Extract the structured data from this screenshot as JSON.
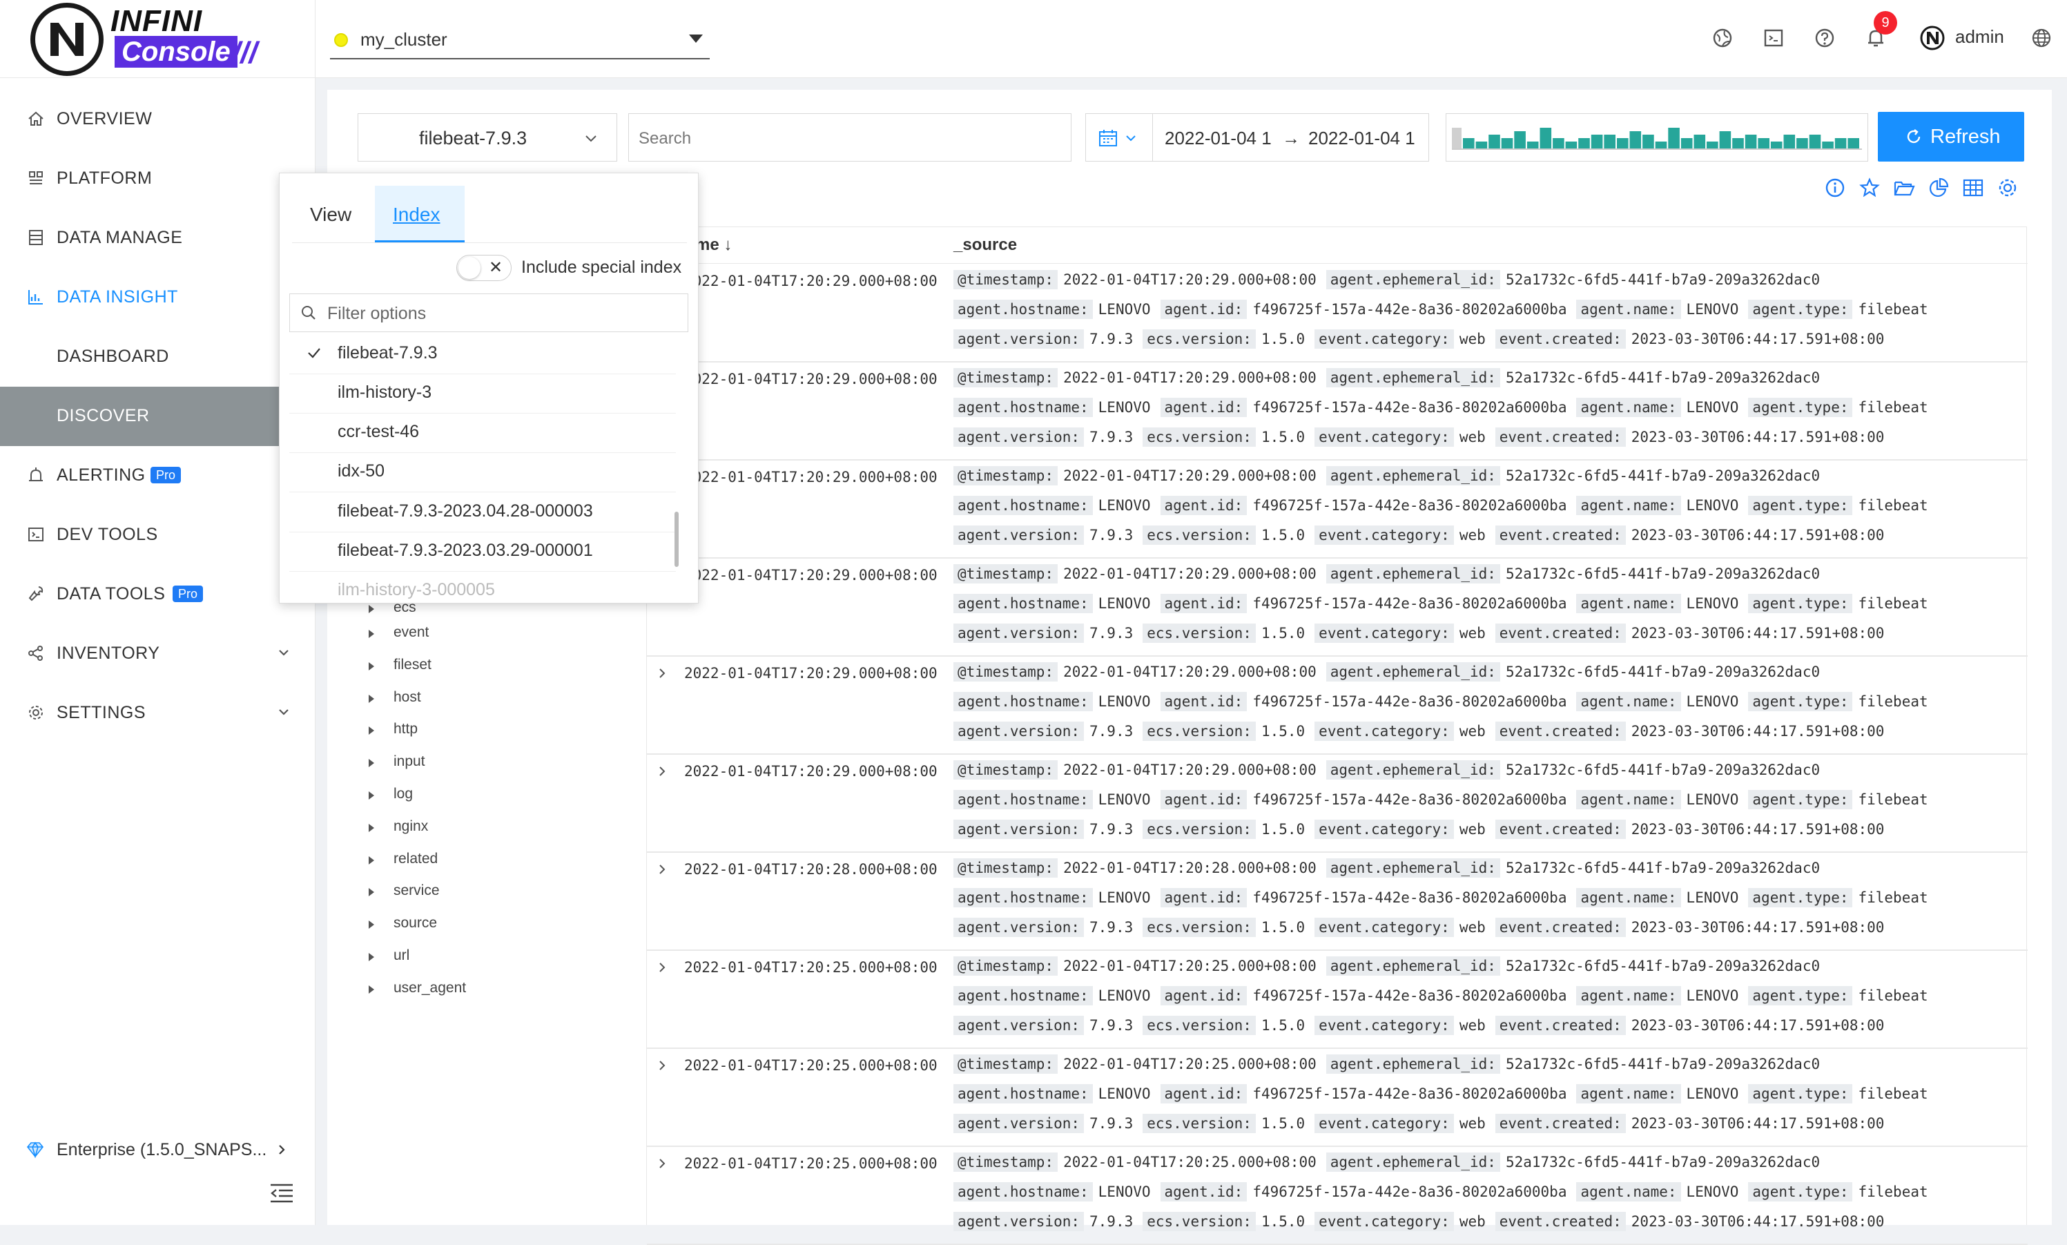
{
  "header": {
    "logo_top": "INFINI",
    "logo_bottom": "Console",
    "logo_slashes": "///",
    "cluster_name": "my_cluster",
    "notification_count": "9",
    "user_name": "admin",
    "icons": [
      "status-globe-icon",
      "terminal-icon",
      "help-icon",
      "bell-icon",
      "user-avatar-icon",
      "language-icon"
    ]
  },
  "sidebar": {
    "items": [
      {
        "label": "OVERVIEW",
        "icon": "home-icon"
      },
      {
        "label": "PLATFORM",
        "icon": "platform-icon"
      },
      {
        "label": "DATA MANAGE",
        "icon": "database-icon"
      },
      {
        "label": "DATA INSIGHT",
        "icon": "chart-icon"
      },
      {
        "label": "DASHBOARD"
      },
      {
        "label": "DISCOVER"
      },
      {
        "label": "ALERTING",
        "icon": "alarm-icon",
        "badge": "Pro"
      },
      {
        "label": "DEV TOOLS",
        "icon": "console-icon"
      },
      {
        "label": "DATA TOOLS",
        "icon": "wrench-icon",
        "badge": "Pro"
      },
      {
        "label": "INVENTORY",
        "icon": "share-icon"
      },
      {
        "label": "SETTINGS",
        "icon": "gear-icon"
      }
    ],
    "enterprise": "Enterprise (1.5.0_SNAPS...",
    "accent_color": "#1890ff",
    "selected_bg": "#8c9396"
  },
  "toolbar": {
    "index_value": "filebeat-7.9.3",
    "search_placeholder": "Search",
    "date_from": "2022-01-04 1",
    "date_arrow": "→",
    "date_to": "2022-01-04 1",
    "refresh_label": "Refresh",
    "histogram_values": [
      3,
      2,
      4,
      3,
      5,
      2,
      6,
      3,
      2,
      3,
      4,
      4,
      3,
      5,
      4,
      2,
      6,
      3,
      4,
      2,
      5,
      3,
      4,
      3,
      2,
      4,
      3,
      4,
      2,
      3,
      3
    ]
  },
  "dropdown": {
    "tab_view": "View",
    "tab_index": "Index",
    "include_special": "Include special index",
    "toggle_x": "✕",
    "filter_placeholder": "Filter options",
    "options": [
      "filebeat-7.9.3",
      "ilm-history-3",
      "ccr-test-46",
      "idx-50",
      "filebeat-7.9.3-2023.04.28-000003",
      "filebeat-7.9.3-2023.03.29-000001",
      "ilm-history-3-000005"
    ],
    "selected_index": 0
  },
  "fields": [
    "ecs",
    "event",
    "fileset",
    "host",
    "http",
    "input",
    "log",
    "nginx",
    "related",
    "service",
    "source",
    "url",
    "user_agent"
  ],
  "table": {
    "col_time": "me ↓",
    "col_source": "_source",
    "rows": [
      {
        "time": "2022-01-04T17:20:29.000+08:00",
        "ts": "2022-01-04T17:20:29.000+08:00"
      },
      {
        "time": "2022-01-04T17:20:29.000+08:00",
        "ts": "2022-01-04T17:20:29.000+08:00"
      },
      {
        "time": "2022-01-04T17:20:29.000+08:00",
        "ts": "2022-01-04T17:20:29.000+08:00"
      },
      {
        "time": "2022-01-04T17:20:29.000+08:00",
        "ts": "2022-01-04T17:20:29.000+08:00"
      },
      {
        "time": "2022-01-04T17:20:29.000+08:00",
        "ts": "2022-01-04T17:20:29.000+08:00"
      },
      {
        "time": "2022-01-04T17:20:29.000+08:00",
        "ts": "2022-01-04T17:20:29.000+08:00"
      },
      {
        "time": "2022-01-04T17:20:28.000+08:00",
        "ts": "2022-01-04T17:20:28.000+08:00"
      },
      {
        "time": "2022-01-04T17:20:25.000+08:00",
        "ts": "2022-01-04T17:20:25.000+08:00"
      },
      {
        "time": "2022-01-04T17:20:25.000+08:00",
        "ts": "2022-01-04T17:20:25.000+08:00"
      },
      {
        "time": "2022-01-04T17:20:25.000+08:00",
        "ts": "2022-01-04T17:20:25.000+08:00"
      }
    ],
    "src": {
      "k_timestamp": "@timestamp:",
      "k_ephemeral": "agent.ephemeral_id:",
      "v_ephemeral": "52a1732c-6fd5-441f-b7a9-209a3262dac0",
      "k_hostname": "agent.hostname:",
      "v_hostname": "LENOVO",
      "k_id": "agent.id:",
      "v_id": "f496725f-157a-442e-8a36-80202a6000ba",
      "k_name": "agent.name:",
      "v_name": "LENOVO",
      "k_type": "agent.type:",
      "v_type": "filebeat",
      "k_version": "agent.version:",
      "v_version": "7.9.3",
      "k_ecs": "ecs.version:",
      "v_ecs": "1.5.0",
      "k_category": "event.category:",
      "v_category": "web",
      "k_created": "event.created:",
      "v_created": "2023-03-30T06:44:17.591+08:00"
    }
  }
}
